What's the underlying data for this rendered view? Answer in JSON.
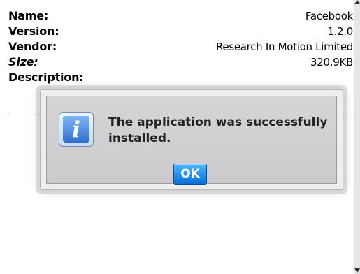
{
  "details": [
    {
      "label": "Name:",
      "value": "Facebook"
    },
    {
      "label": "Version:",
      "value": "1.2.0"
    },
    {
      "label": "Vendor:",
      "value": "Research In Motion Limited"
    },
    {
      "label": "Size:",
      "value": "320.9KB"
    },
    {
      "label": "Description:",
      "value": ""
    }
  ],
  "dialog": {
    "message": "The application was successfully installed.",
    "ok_label": "OK",
    "icon": "info-icon"
  }
}
